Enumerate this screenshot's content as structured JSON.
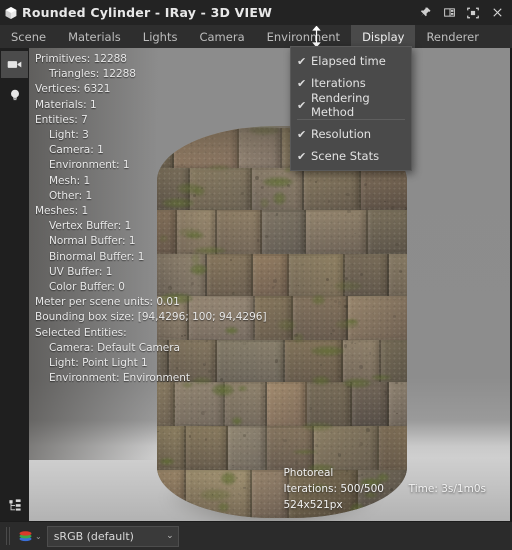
{
  "titlebar": {
    "icon": "cube-icon",
    "title": "Rounded Cylinder - IRay - 3D VIEW",
    "buttons": [
      {
        "name": "pin-button",
        "glyph": "pin-icon"
      },
      {
        "name": "dock-button",
        "glyph": "panel-icon"
      },
      {
        "name": "maximize-button",
        "glyph": "fit-icon"
      },
      {
        "name": "close-button",
        "glyph": "close-icon"
      }
    ]
  },
  "tabs": [
    {
      "label": "Scene",
      "active": false
    },
    {
      "label": "Materials",
      "active": false
    },
    {
      "label": "Lights",
      "active": false
    },
    {
      "label": "Camera",
      "active": false
    },
    {
      "label": "Environment",
      "active": false
    },
    {
      "label": "Display",
      "active": true
    },
    {
      "label": "Renderer",
      "active": false
    }
  ],
  "toolstrip": {
    "items": [
      {
        "name": "camera-tool",
        "icon": "camera-icon",
        "active": true
      },
      {
        "name": "light-tool",
        "icon": "lightbulb-icon",
        "active": false
      }
    ],
    "bottom": {
      "name": "scene-tree-tool",
      "icon": "tree-icon"
    }
  },
  "display_menu": {
    "items": [
      {
        "label": "Elapsed time",
        "checked": true
      },
      {
        "label": "Iterations",
        "checked": true
      },
      {
        "label": "Rendering Method",
        "checked": true
      },
      {
        "separator": true
      },
      {
        "label": "Resolution",
        "checked": true
      },
      {
        "label": "Scene Stats",
        "checked": true
      }
    ],
    "check_glyph": "✔"
  },
  "scene_stats": [
    {
      "text": "Primitives: 12288",
      "indent": 0
    },
    {
      "text": "Triangles: 12288",
      "indent": 1
    },
    {
      "text": "Vertices: 6321",
      "indent": 0
    },
    {
      "text": "Materials: 1",
      "indent": 0
    },
    {
      "text": "Entities: 7",
      "indent": 0
    },
    {
      "text": "Light: 3",
      "indent": 1
    },
    {
      "text": "Camera: 1",
      "indent": 1
    },
    {
      "text": "Environment: 1",
      "indent": 1
    },
    {
      "text": "Mesh: 1",
      "indent": 1
    },
    {
      "text": "Other: 1",
      "indent": 1
    },
    {
      "text": "Meshes: 1",
      "indent": 0
    },
    {
      "text": "Vertex Buffer: 1",
      "indent": 1
    },
    {
      "text": "Normal Buffer: 1",
      "indent": 1
    },
    {
      "text": "Binormal Buffer: 1",
      "indent": 1
    },
    {
      "text": "UV Buffer: 1",
      "indent": 1
    },
    {
      "text": "Color Buffer: 0",
      "indent": 1
    },
    {
      "text": "Meter per scene units: 0.01",
      "indent": 0
    },
    {
      "text": "Bounding box size: [94,4296; 100; 94,4296]",
      "indent": 0
    },
    {
      "text": "Selected Entities:",
      "indent": 0
    },
    {
      "text": "Camera: Default Camera",
      "indent": 1
    },
    {
      "text": "Light: Point Light 1",
      "indent": 1
    },
    {
      "text": "Environment: Environment",
      "indent": 1
    }
  ],
  "render_info": {
    "method": "Photoreal",
    "iterations_label": "Iterations: 500/500",
    "time_label": "Time: 3s/1m0s",
    "resolution": "524x521px"
  },
  "statusbar": {
    "color_icon": "color-stack-icon",
    "colorspace_value": "sRGB (default)",
    "chevron": "⌄"
  },
  "colors": {
    "titlebar_bg": "#232323",
    "tabbar_bg": "#2e2e2e",
    "active_tab_bg": "#4a4a4a",
    "menu_bg": "#4a4a4a",
    "toolstrip_bg": "#1f1f1f",
    "statusbar_bg": "#2b2b2b",
    "text": "#e2e2e2",
    "viewport_bg": "#8e8e8e"
  }
}
